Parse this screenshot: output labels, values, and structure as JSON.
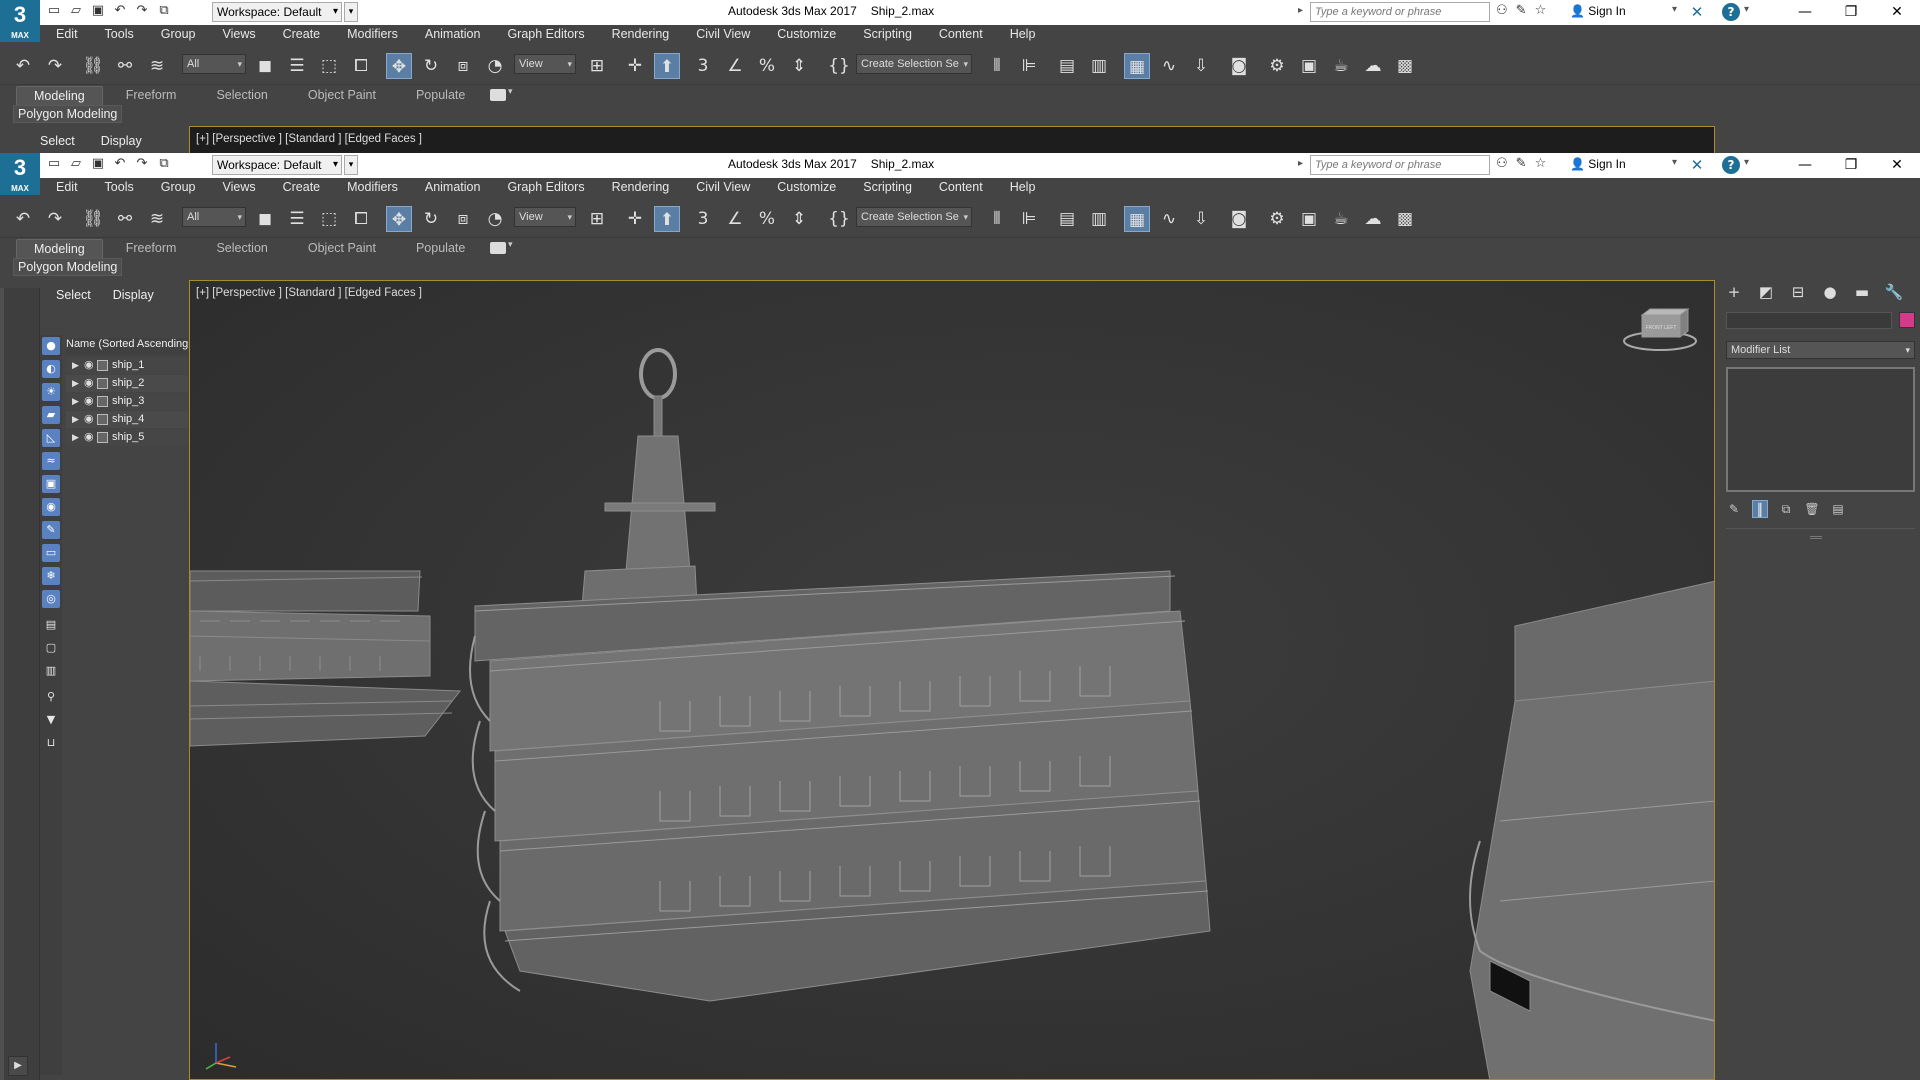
{
  "app": {
    "logo": "3",
    "logo_sub": "MAX",
    "title": "Autodesk 3ds Max 2017",
    "file": "Ship_2.max",
    "workspace": "Workspace: Default",
    "search_placeholder": "Type a keyword or phrase",
    "sign_in": "Sign In"
  },
  "menu": [
    "Edit",
    "Tools",
    "Group",
    "Views",
    "Create",
    "Modifiers",
    "Animation",
    "Graph Editors",
    "Rendering",
    "Civil View",
    "Customize",
    "Scripting",
    "Content",
    "Help"
  ],
  "toolbar": {
    "selection_filter": "All",
    "reference_coord": "View",
    "named_selection": "Create Selection Se",
    "active_tool": "select-and-move"
  },
  "ribbon": {
    "tabs": [
      "Modeling",
      "Freeform",
      "Selection",
      "Object Paint",
      "Populate"
    ],
    "active_tab": "Modeling",
    "panel": "Polygon Modeling"
  },
  "explorer": {
    "tabs": [
      "Select",
      "Display"
    ],
    "column_header": "Name (Sorted Ascending)",
    "objects": [
      "ship_1",
      "ship_2",
      "ship_3",
      "ship_4",
      "ship_5"
    ]
  },
  "viewport": {
    "label": "[+] [Perspective ] [Standard ] [Edged Faces ]",
    "viewcube_label": "FRONT LEFT"
  },
  "command_panel": {
    "modifier_list": "Modifier List",
    "object_color": "#d53a8a"
  }
}
